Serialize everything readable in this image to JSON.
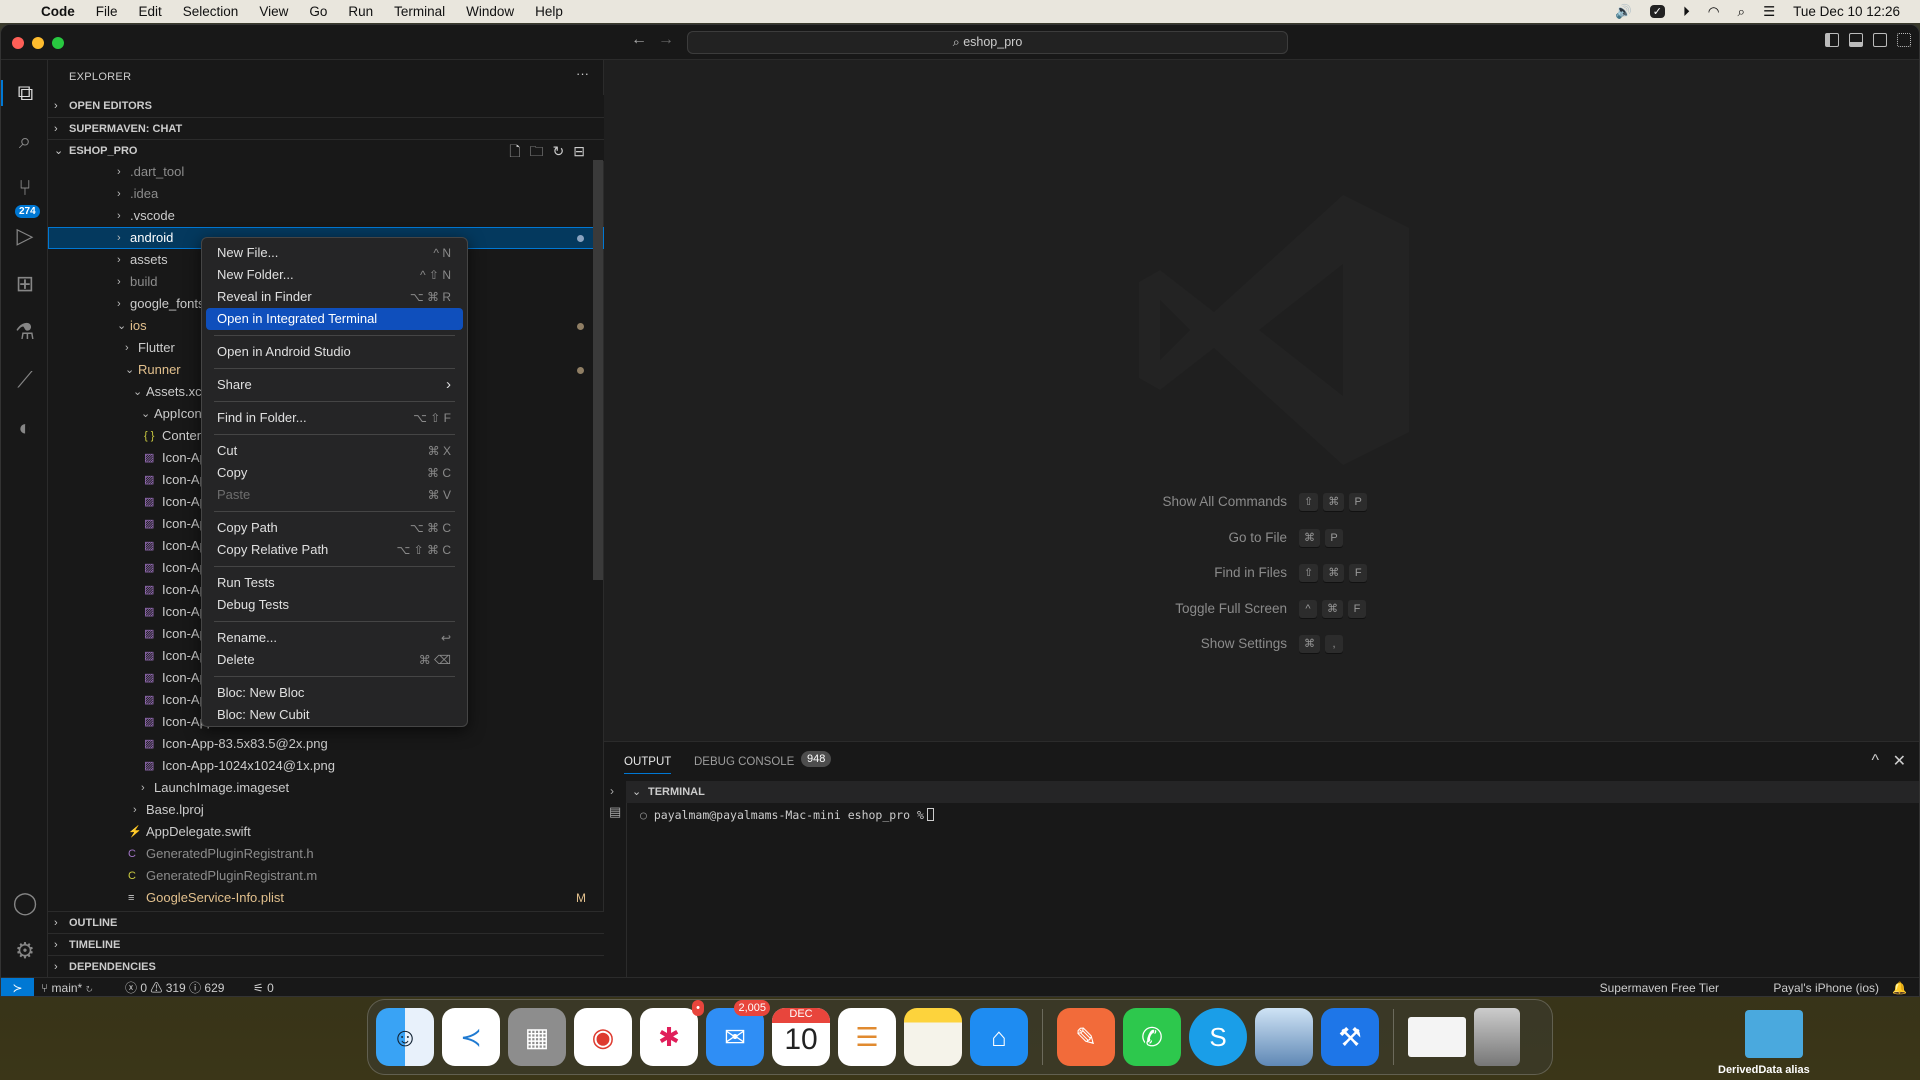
{
  "menubar": {
    "app": "Code",
    "items": [
      "File",
      "Edit",
      "Selection",
      "View",
      "Go",
      "Run",
      "Terminal",
      "Window",
      "Help"
    ],
    "clock": "Tue Dec 10  12:26"
  },
  "titlebar": {
    "search": "eshop_pro"
  },
  "activity": {
    "scm_badge": "274"
  },
  "explorer": {
    "title": "EXPLORER",
    "more": "···",
    "open_editors": "OPEN EDITORS",
    "supermaven_chat": "SUPERMAVEN: CHAT",
    "project": "ESHOP_PRO",
    "tree": [
      {
        "label": ".dart_tool",
        "level": 1,
        "kind": "folder",
        "open": false,
        "style": "dim"
      },
      {
        "label": ".idea",
        "level": 1,
        "kind": "folder",
        "open": false,
        "style": "dim"
      },
      {
        "label": ".vscode",
        "level": 1,
        "kind": "folder",
        "open": false
      },
      {
        "label": "android",
        "level": 1,
        "kind": "folder",
        "open": false,
        "selected": true,
        "dot": true
      },
      {
        "label": "assets",
        "level": 1,
        "kind": "folder",
        "open": false
      },
      {
        "label": "build",
        "level": 1,
        "kind": "folder",
        "open": false,
        "style": "dim"
      },
      {
        "label": "google_fonts",
        "level": 1,
        "kind": "folder",
        "open": false
      },
      {
        "label": "ios",
        "level": 1,
        "kind": "folder",
        "open": true,
        "style": "mod",
        "dot": true
      },
      {
        "label": "Flutter",
        "level": 2,
        "kind": "folder",
        "open": false
      },
      {
        "label": "Runner",
        "level": 2,
        "kind": "folder",
        "open": true,
        "style": "mod",
        "dot": true
      },
      {
        "label": "Assets.xcassets",
        "level": 3,
        "kind": "folder",
        "open": true
      },
      {
        "label": "AppIcon.appico",
        "level": 4,
        "kind": "folder",
        "open": true
      },
      {
        "label": "Contents.json",
        "level": 5,
        "kind": "json"
      },
      {
        "label": "Icon-App-20x",
        "level": 5,
        "kind": "image"
      },
      {
        "label": "Icon-App-20x",
        "level": 5,
        "kind": "image"
      },
      {
        "label": "Icon-App-20x",
        "level": 5,
        "kind": "image"
      },
      {
        "label": "Icon-App-29x",
        "level": 5,
        "kind": "image"
      },
      {
        "label": "Icon-App-29x",
        "level": 5,
        "kind": "image"
      },
      {
        "label": "Icon-App-29x",
        "level": 5,
        "kind": "image"
      },
      {
        "label": "Icon-App-40x",
        "level": 5,
        "kind": "image"
      },
      {
        "label": "Icon-App-40x",
        "level": 5,
        "kind": "image"
      },
      {
        "label": "Icon-App-40x",
        "level": 5,
        "kind": "image"
      },
      {
        "label": "Icon-App-60x",
        "level": 5,
        "kind": "image"
      },
      {
        "label": "Icon-App-60x",
        "level": 5,
        "kind": "image"
      },
      {
        "label": "Icon-App-76x",
        "level": 5,
        "kind": "image"
      },
      {
        "label": "Icon-App-76x",
        "level": 5,
        "kind": "image"
      },
      {
        "label": "Icon-App-83.5x83.5@2x.png",
        "level": 5,
        "kind": "image"
      },
      {
        "label": "Icon-App-1024x1024@1x.png",
        "level": 5,
        "kind": "image"
      },
      {
        "label": "LaunchImage.imageset",
        "level": 4,
        "kind": "folder",
        "open": false
      },
      {
        "label": "Base.lproj",
        "level": 3,
        "kind": "folder",
        "open": false
      },
      {
        "label": "AppDelegate.swift",
        "level": 3,
        "kind": "swift"
      },
      {
        "label": "GeneratedPluginRegistrant.h",
        "level": 3,
        "kind": "c-header",
        "style": "dim"
      },
      {
        "label": "GeneratedPluginRegistrant.m",
        "level": 3,
        "kind": "c-source",
        "style": "dim"
      },
      {
        "label": "GoogleService-Info.plist",
        "level": 3,
        "kind": "plist",
        "style": "mod",
        "mark": "M"
      }
    ],
    "outline": "OUTLINE",
    "timeline": "TIMELINE",
    "dependencies": "DEPENDENCIES"
  },
  "context_menu": {
    "items": [
      {
        "label": "New File...",
        "shortcut": "^ N"
      },
      {
        "label": "New Folder...",
        "shortcut": "^ ⇧ N"
      },
      {
        "label": "Reveal in Finder",
        "shortcut": "⌥ ⌘ R"
      },
      {
        "label": "Open in Integrated Terminal",
        "shortcut": "",
        "highlighted": true
      },
      {
        "sep": true
      },
      {
        "label": "Open in Android Studio",
        "shortcut": ""
      },
      {
        "sep": true
      },
      {
        "label": "Share",
        "shortcut": "›"
      },
      {
        "sep": true
      },
      {
        "label": "Find in Folder...",
        "shortcut": "⌥ ⇧ F"
      },
      {
        "sep": true
      },
      {
        "label": "Cut",
        "shortcut": "⌘ X"
      },
      {
        "label": "Copy",
        "shortcut": "⌘ C"
      },
      {
        "label": "Paste",
        "shortcut": "⌘ V",
        "disabled": true
      },
      {
        "sep": true
      },
      {
        "label": "Copy Path",
        "shortcut": "⌥ ⌘ C"
      },
      {
        "label": "Copy Relative Path",
        "shortcut": "⌥ ⇧ ⌘ C"
      },
      {
        "sep": true
      },
      {
        "label": "Run Tests",
        "shortcut": ""
      },
      {
        "label": "Debug Tests",
        "shortcut": ""
      },
      {
        "sep": true
      },
      {
        "label": "Rename...",
        "shortcut": "↩"
      },
      {
        "label": "Delete",
        "shortcut": "⌘ ⌫"
      },
      {
        "sep": true
      },
      {
        "label": "Bloc: New Bloc",
        "shortcut": ""
      },
      {
        "label": "Bloc: New Cubit",
        "shortcut": ""
      }
    ]
  },
  "editor": {
    "shortcuts": [
      {
        "label": "Show All Commands",
        "keys": [
          "⇧",
          "⌘",
          "P"
        ]
      },
      {
        "label": "Go to File",
        "keys": [
          "⌘",
          "P"
        ]
      },
      {
        "label": "Find in Files",
        "keys": [
          "⇧",
          "⌘",
          "F"
        ]
      },
      {
        "label": "Toggle Full Screen",
        "keys": [
          "^",
          "⌘",
          "F"
        ]
      },
      {
        "label": "Show Settings",
        "keys": [
          "⌘",
          ","
        ]
      }
    ]
  },
  "panel": {
    "tabs": [
      {
        "label": "OUTPUT",
        "active": true
      },
      {
        "label": "DEBUG CONSOLE"
      }
    ],
    "debug_count": "948",
    "terminal_header": "TERMINAL",
    "prompt": "payalmam@payalmams-Mac-mini eshop_pro %"
  },
  "status": {
    "branch": "main*",
    "errors": "0",
    "warnings": "319",
    "infos": "629",
    "ports": "0",
    "supermaven": "Supermaven Free Tier",
    "device": "Payal's iPhone (ios)"
  },
  "dock": {
    "apps": [
      "finder",
      "vscode",
      "launchpad",
      "chrome",
      "slack",
      "mail",
      "calendar",
      "reminders",
      "notes",
      "keynote",
      "postman",
      "whatsapp",
      "skype",
      "preview",
      "xcode",
      "chrome-window",
      "trash"
    ],
    "slack_badge": "•",
    "mail_badge": "2,005",
    "calendar_month": "DEC",
    "calendar_day": "10"
  },
  "desktop": {
    "folder_label": "DerivedData alias"
  },
  "colors": {
    "accent": "#0078d4",
    "menu_highlight": "#0f4fbc",
    "modified": "#e2c08d",
    "selection": "#04395e"
  }
}
